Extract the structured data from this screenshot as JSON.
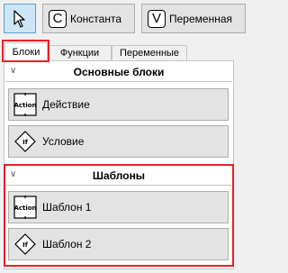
{
  "toolbar": {
    "constant_letter": "C",
    "constant_label": "Константа",
    "variable_letter": "V",
    "variable_label": "Переменная"
  },
  "tabs": [
    {
      "label": "Блоки",
      "active": true
    },
    {
      "label": "Функции",
      "active": false
    },
    {
      "label": "Переменные",
      "active": false
    }
  ],
  "sections": [
    {
      "title": "Основные блоки",
      "items": [
        {
          "label": "Действие",
          "icon_text": "Action"
        },
        {
          "label": "Условие",
          "icon_text": "If"
        }
      ]
    },
    {
      "title": "Шаблоны",
      "items": [
        {
          "label": "Шаблон 1",
          "icon_text": "Action"
        },
        {
          "label": "Шаблон 2",
          "icon_text": "If"
        }
      ]
    }
  ],
  "colors": {
    "highlight": "#e8202a",
    "pointer_bg": "#cde6f7"
  }
}
